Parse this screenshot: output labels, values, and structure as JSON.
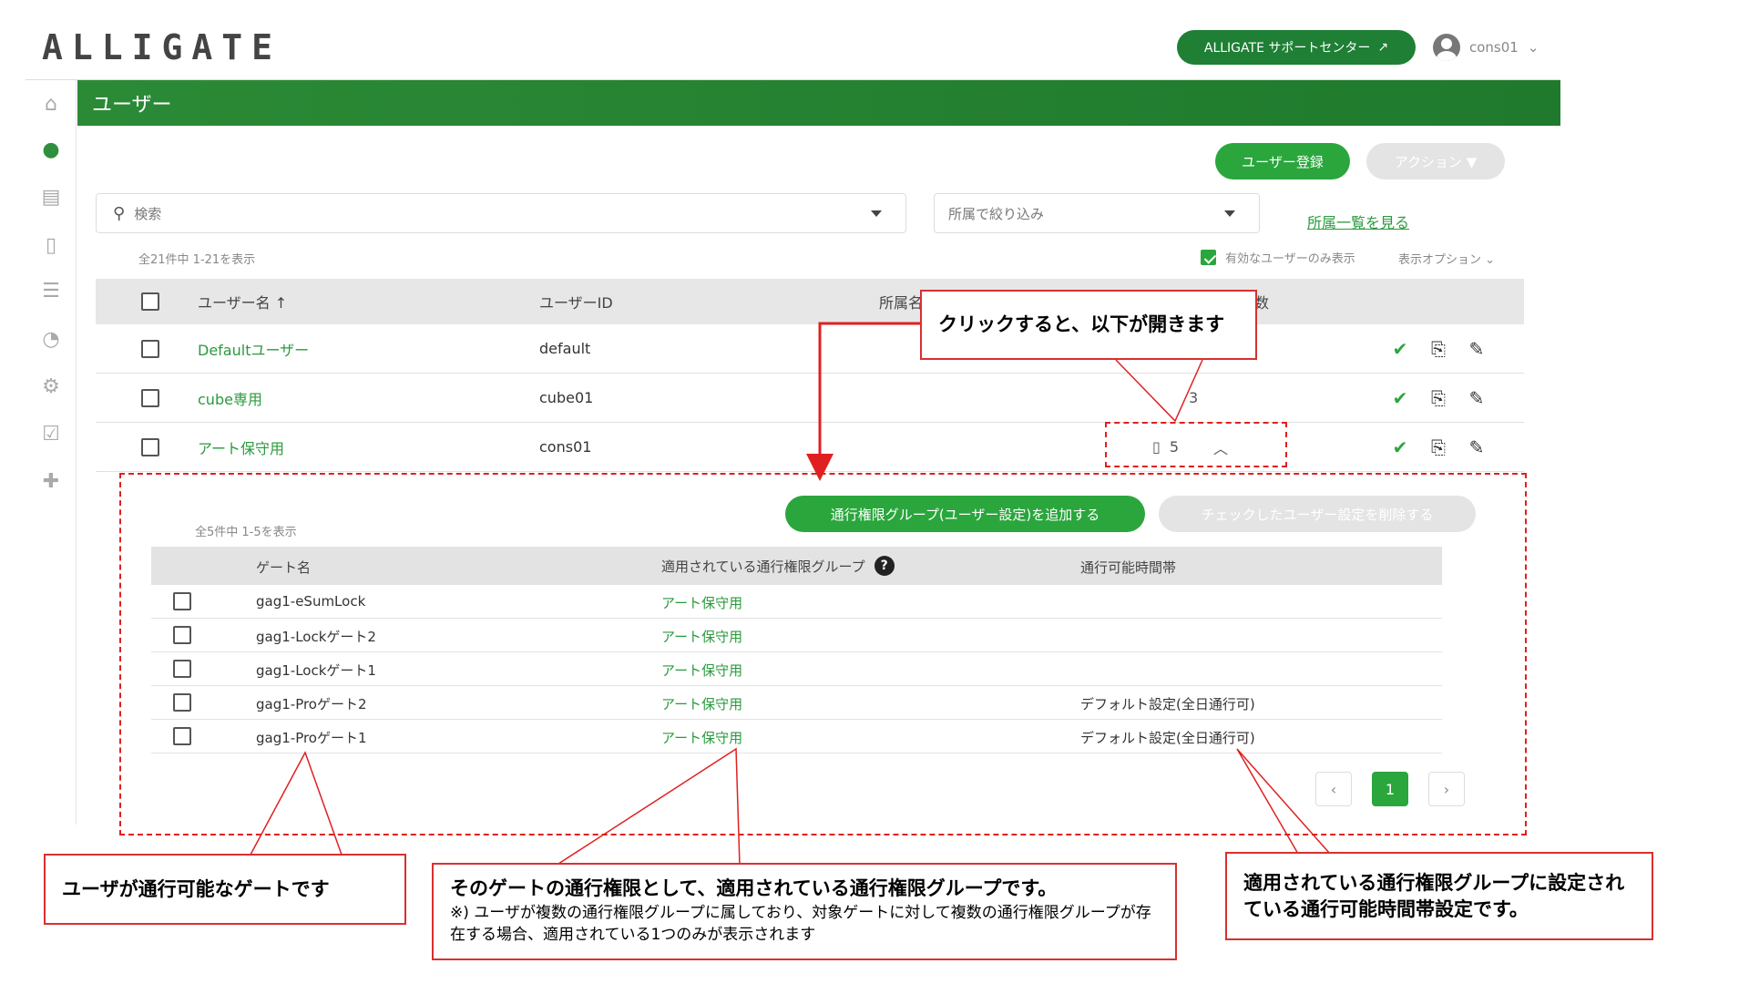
{
  "header": {
    "logo_text": "ALLIGATE",
    "support_label": "ALLIGATE サポートセンター",
    "username": "cons01"
  },
  "page": {
    "title": "ユーザー",
    "register_label": "ユーザー登録",
    "action_label": "アクション ▼"
  },
  "search": {
    "placeholder": "検索",
    "filter_placeholder": "所属で絞り込み",
    "affiliation_link": "所属一覧を見る",
    "count_text": "全21件中 1-21を表示",
    "active_only_label": "有効なユーザーのみ表示",
    "display_options_label": "表示オプション"
  },
  "table": {
    "headers": {
      "name": "ユーザー名",
      "id": "ユーザーID",
      "affiliation": "所属名",
      "count": "数"
    },
    "rows": [
      {
        "name": "Defaultユーザー",
        "id": "default",
        "gates": ""
      },
      {
        "name": "cube専用",
        "id": "cube01",
        "gates": "3"
      },
      {
        "name": "アート保守用",
        "id": "cons01",
        "gates": "5"
      }
    ]
  },
  "subpanel": {
    "count_text": "全5件中 1-5を表示",
    "add_label": "通行権限グループ(ユーザー設定)を追加する",
    "delete_label": "チェックしたユーザー設定を削除する",
    "headers": {
      "gate": "ゲート名",
      "group": "適用されている通行権限グループ",
      "time": "通行可能時間帯"
    },
    "rows": [
      {
        "gate": "gag1-eSumLock",
        "group": "アート保守用",
        "time": ""
      },
      {
        "gate": "gag1-Lockゲート2",
        "group": "アート保守用",
        "time": ""
      },
      {
        "gate": "gag1-Lockゲート1",
        "group": "アート保守用",
        "time": ""
      },
      {
        "gate": "gag1-Proゲート2",
        "group": "アート保守用",
        "time": "デフォルト設定(全日通行可)"
      },
      {
        "gate": "gag1-Proゲート1",
        "group": "アート保守用",
        "time": "デフォルト設定(全日通行可)"
      }
    ],
    "pagination": {
      "prev": "‹",
      "current": "1",
      "next": "›"
    }
  },
  "callouts": {
    "top": "クリックすると、以下が開きます",
    "gate": "ユーザが通行可能なゲートです",
    "group_main": "そのゲートの通行権限として、適用されている通行権限グループです。",
    "group_note": "※) ユーザが複数の通行権限グループに属しており、対象ゲートに対して複数の通行権限グループが存在する場合、適用されている1つのみが表示されます",
    "time": "適用されている通行権限グループに設定されている通行可能時間帯設定です。"
  },
  "colors": {
    "brand_green": "#2aa63d",
    "header_green": "#1f7a2d",
    "annotation_red": "#e02020"
  }
}
